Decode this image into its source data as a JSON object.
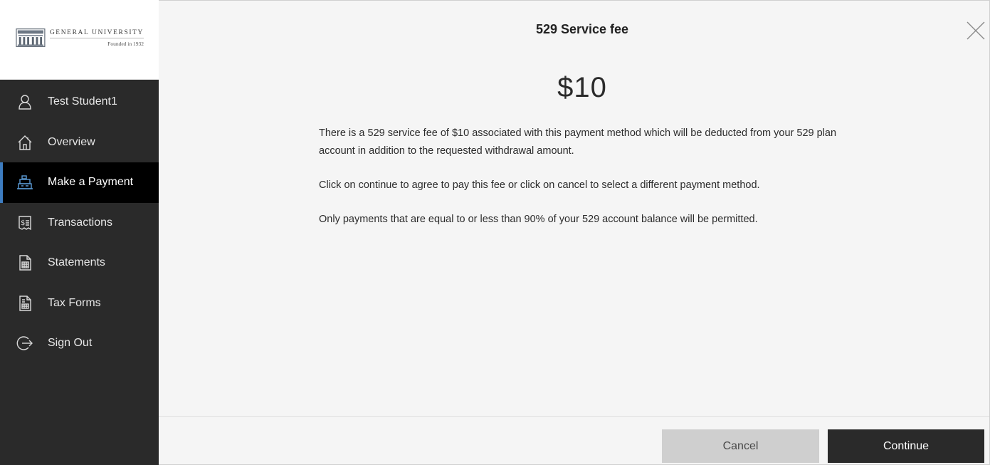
{
  "brand": {
    "name": "GENERAL UNIVERSITY",
    "tagline": "Founded in 1932"
  },
  "sidebar": {
    "items": [
      {
        "label": "Test Student1",
        "icon": "user-icon",
        "active": false
      },
      {
        "label": "Overview",
        "icon": "home-icon",
        "active": false
      },
      {
        "label": "Make a Payment",
        "icon": "cash-register-icon",
        "active": true
      },
      {
        "label": "Transactions",
        "icon": "dollar-document-icon",
        "active": false
      },
      {
        "label": "Statements",
        "icon": "statement-icon",
        "active": false
      },
      {
        "label": "Tax Forms",
        "icon": "tax-form-icon",
        "active": false
      },
      {
        "label": "Sign Out",
        "icon": "sign-out-icon",
        "active": false
      }
    ],
    "active_accent": "#3d7cc0"
  },
  "dialog": {
    "title": "529 Service fee",
    "amount": "$10",
    "messages": [
      "There is a 529 service fee of $10 associated with this payment method which will be deducted from your 529 plan account in addition to the requested withdrawal amount.",
      "Click on continue to agree to pay this fee or click on cancel to select a different payment method.",
      "Only payments that are equal to or less than 90% of your 529 account balance will be permitted."
    ],
    "cancel_label": "Cancel",
    "continue_label": "Continue"
  }
}
